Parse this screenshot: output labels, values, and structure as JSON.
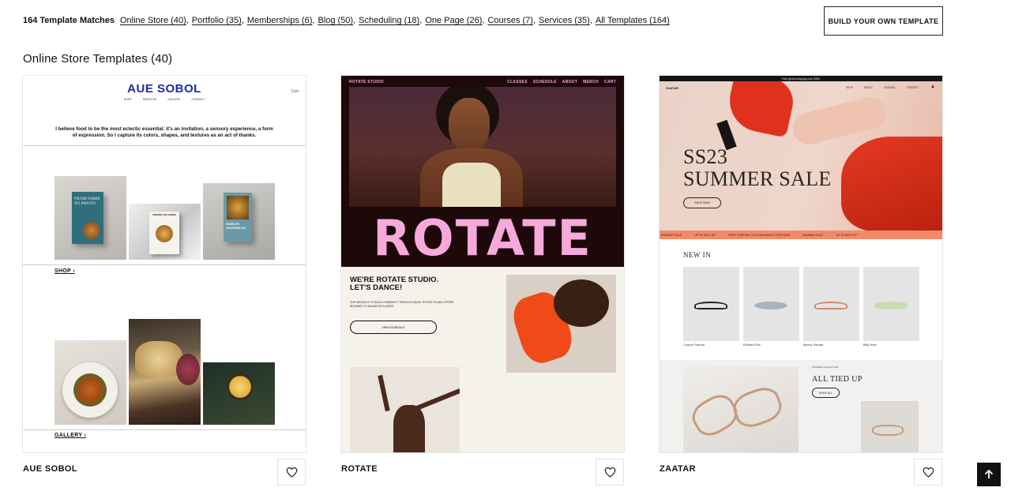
{
  "filters": {
    "count": "164 Template Matches",
    "links": [
      {
        "label": "Online Store (40)",
        "sep": ","
      },
      {
        "label": "Portfolio (35)",
        "sep": ","
      },
      {
        "label": "Memberships (6)",
        "sep": ","
      },
      {
        "label": "Blog (50)",
        "sep": ","
      },
      {
        "label": "Scheduling (18)",
        "sep": ","
      },
      {
        "label": "One Page (26)",
        "sep": ","
      },
      {
        "label": "Courses (7)",
        "sep": ","
      },
      {
        "label": "Services (35)",
        "sep": ","
      },
      {
        "label": "All Templates (164)",
        "sep": ""
      }
    ]
  },
  "build_button": "BUILD YOUR OWN TEMPLATE",
  "section_title": "Online Store Templates (40)",
  "cards": [
    {
      "name": "AUE SOBOL",
      "preview": {
        "logo": "AUE SOBOL",
        "nav": [
          "SHOP",
          "SERVICES",
          "GALLERY",
          "CONTACT"
        ],
        "cart": "Cart",
        "intro": "I believe food to be the most eclectic essential: it's an invitation, a sensory experience, a form of expression. So I capture its colors, shapes, and textures as an act of thanks.",
        "book1": "FROM FARM TO PHOTO",
        "book2": "FEEDING THE HANDS",
        "book3": "EDIBLES ASSEMBLED",
        "shop_link": "SHOP",
        "gallery_link": "GALLERY"
      }
    },
    {
      "name": "ROTATE",
      "preview": {
        "brand": "ROTATE STUDIO",
        "nav": [
          "CLASSES",
          "SCHEDULE",
          "ABOUT",
          "MERCH",
          "CART"
        ],
        "wordmark": "ROTATE",
        "headline": "WE'RE ROTATE STUDIO. LET'S DANCE!",
        "body": "OUR MISSION IS TO BUILD COMMUNITY THROUGH DANCE. ROTATE STUDIO OFFERS BEGINNER TO ADVANCED CLASSES",
        "button": "VIEW SCHEDULE"
      }
    },
    {
      "name": "ZAATAR",
      "preview": {
        "banner": "Free global shipping over $150",
        "brand": "ZAATAR",
        "nav": [
          "SHOP",
          "ABOUT",
          "JOURNAL",
          "CONTACT"
        ],
        "title_line1": "SS23",
        "title_line2": "SUMMER SALE",
        "shop_now": "SHOP NOW",
        "ticker": [
          "SUMMER SALE",
          "UP TO 50% OFF",
          "FREE SHIPPING ON PURCHASES OVER $150",
          "SUMMER SALE",
          "UP TO 50% OFF"
        ],
        "new_in": "NEW IN",
        "products": [
          {
            "name": "Cooper Sandal"
          },
          {
            "name": "Richard Flat"
          },
          {
            "name": "Benny Sandal"
          },
          {
            "name": "Billy Heel"
          }
        ],
        "collection_label": "SUMMER COLLECTION",
        "tied_up": "ALL TIED UP",
        "shop_all": "SHOP ALL"
      }
    }
  ],
  "icons": {
    "favorite": "heart-icon",
    "back_to_top": "arrow-up-icon"
  },
  "colors": {
    "aue_blue": "#1a2aa8",
    "rotate_pink": "#f7a9db",
    "rotate_dark": "#1d0909",
    "zaatar_red": "#e0311f",
    "zaatar_ticker": "#f28a6a"
  }
}
